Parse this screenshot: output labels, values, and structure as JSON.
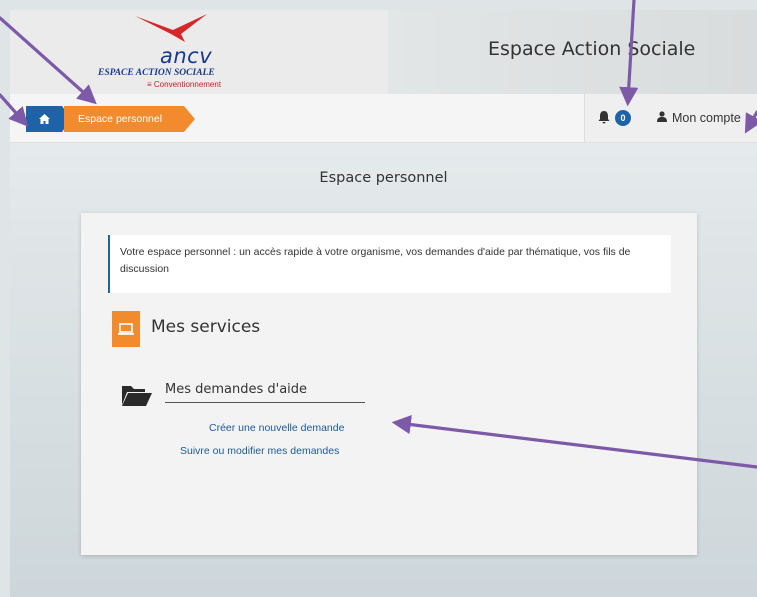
{
  "header": {
    "logo_text": "ancv",
    "logo_subtitle": "ESPACE ACTION SOCIALE",
    "logo_tagline": "≡ Conventionnement",
    "app_title": "Espace Action Sociale"
  },
  "navbar": {
    "home_icon": "home-icon",
    "breadcrumb": "Espace personnel",
    "notifications_count": "0",
    "account_label": "Mon compte"
  },
  "main": {
    "page_title": "Espace personnel",
    "intro_text": "Votre espace personnel : un accès rapide à votre organisme, vos demandes d'aide par thématique, vos fils de discussion",
    "services_title": "Mes services",
    "demandes_title": "Mes demandes d'aide",
    "link_create": "Créer une nouvelle demande",
    "link_follow": "Suivre ou modifier mes demandes"
  },
  "colors": {
    "accent_blue": "#1e63a8",
    "accent_orange": "#f28a2e",
    "annotation_purple": "#7d5aa8"
  }
}
